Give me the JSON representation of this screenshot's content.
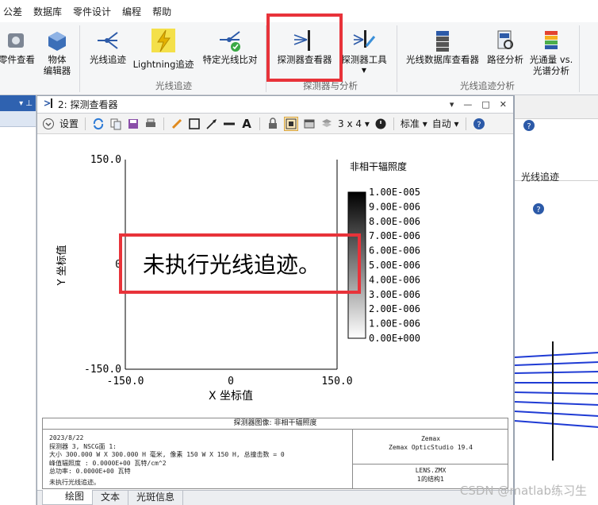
{
  "menubar": {
    "items": [
      "公差",
      "数据库",
      "零件设计",
      "编程",
      "帮助"
    ]
  },
  "ribbon": {
    "buttons": {
      "part_viewer": "零件查看",
      "object_editor_l1": "物体",
      "object_editor_l2": "编辑器",
      "ray_trace": "光线追迹",
      "lightning_trace": "Lightning追迹",
      "specific_ray_compare": "特定光线比对",
      "detector_viewer": "探测器查看器",
      "detector_tools": "探测器工具",
      "ray_db_viewer": "光线数据库查看器",
      "path_analysis": "路径分析",
      "ray_vs_spectrum_l1": "光通量 vs.",
      "ray_vs_spectrum_l2": "光谱分析"
    },
    "groups": {
      "ray_trace": "光线追迹",
      "detector_analysis": "探测器与分析",
      "ray_trace_analysis": "光线追迹分析"
    }
  },
  "docwindow": {
    "title": "2: 探测查看器",
    "toolbar": {
      "settings": "设置",
      "layout": "3 x 4",
      "standard": "标准",
      "auto": "自动"
    }
  },
  "chart_data": {
    "type": "heatmap",
    "x_ticks": [
      "-150.0",
      "0",
      "150.0"
    ],
    "y_ticks": [
      "150.0",
      "0",
      "-150.0"
    ],
    "xlabel": "X 坐标值",
    "ylabel": "Y 坐标值",
    "xlim": [
      -150,
      150
    ],
    "ylim": [
      -150,
      150
    ],
    "colorbar_title": "非相干辐照度",
    "colorbar_ticks": [
      "1.00E-005",
      "9.00E-006",
      "8.00E-006",
      "7.00E-006",
      "6.00E-006",
      "5.00E-006",
      "4.00E-006",
      "3.00E-006",
      "2.00E-006",
      "1.00E-006",
      "0.00E+000"
    ],
    "message": "未执行光线追迹。"
  },
  "info": {
    "header": "探测器图像: 非相干辐照度",
    "lines": [
      "2023/8/22",
      "探测器 3, NSCG面 1:",
      "大小 300.000 W X 300.000 H 毫米, 像素 150 W X 150 H, 总撞击数 = 0",
      "峰值辐照度 : 0.0000E+00 瓦特/cm^2",
      "总功率: 0.0000E+00 瓦特",
      "未执行光线追迹。"
    ],
    "company": "Zemax",
    "product": "Zemax OpticStudio 19.4",
    "file": "LENS.ZMX",
    "config": "1的结构1"
  },
  "tabs": [
    "绘图",
    "文本",
    "光斑信息"
  ],
  "right_window": {
    "label": "光线追迹"
  },
  "watermark": "CSDN @matlab练习生",
  "colors": {
    "highlight": "#e8333a",
    "ray": "#1f3bd4"
  }
}
